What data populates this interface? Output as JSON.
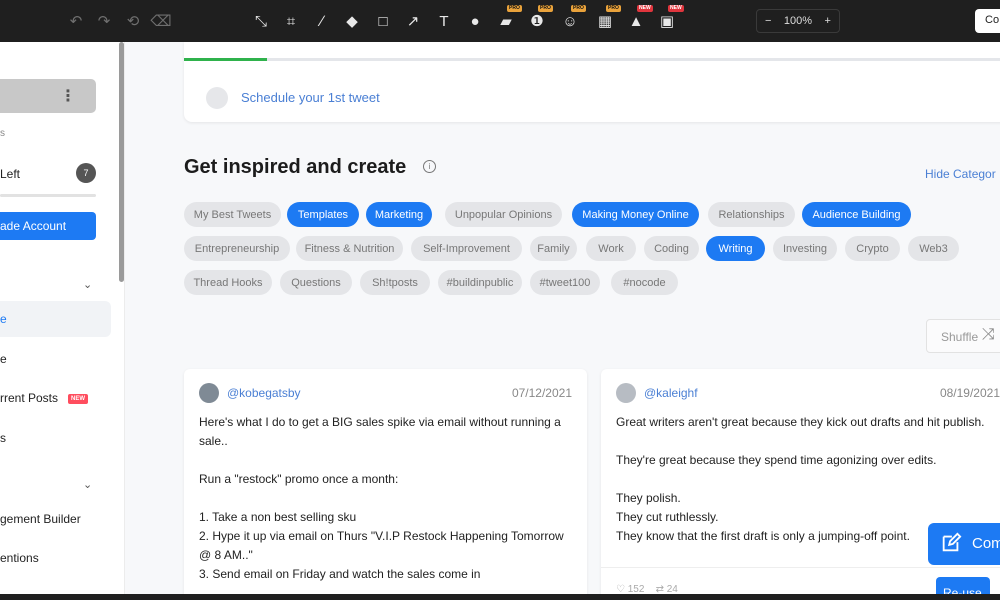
{
  "toolbar": {
    "zoom": {
      "minus": "−",
      "value": "100%",
      "plus": "+"
    },
    "right_button": "Co",
    "pro_badge": "PRO",
    "new_badge": "NEW"
  },
  "sidebar": {
    "account_menu": "⋮",
    "stat_suffix": "s",
    "left_label": "Left",
    "left_count": "7",
    "upgrade_label": "ade Account",
    "items": [
      {
        "label": "e"
      },
      {
        "label": "e"
      },
      {
        "label": "rrent Posts",
        "badge": "NEW"
      },
      {
        "label": "s"
      },
      {
        "label": "gement Builder"
      },
      {
        "label": "entions"
      }
    ]
  },
  "schedule": {
    "text": "Schedule your 1st tweet",
    "progress": 0.1
  },
  "inspire": {
    "title": "Get inspired and create",
    "hide_categories": "Hide Categor"
  },
  "categories": [
    {
      "label": "My Best Tweets",
      "active": false
    },
    {
      "label": "Templates",
      "active": true
    },
    {
      "label": "Marketing",
      "active": true
    },
    {
      "label": "Unpopular Opinions",
      "active": false
    },
    {
      "label": "Making Money Online",
      "active": true
    },
    {
      "label": "Relationships",
      "active": false
    },
    {
      "label": "Audience Building",
      "active": true
    },
    {
      "label": "Entrepreneurship",
      "active": false
    },
    {
      "label": "Fitness & Nutrition",
      "active": false
    },
    {
      "label": "Self-Improvement",
      "active": false
    },
    {
      "label": "Family",
      "active": false
    },
    {
      "label": "Work",
      "active": false
    },
    {
      "label": "Coding",
      "active": false
    },
    {
      "label": "Writing",
      "active": true
    },
    {
      "label": "Investing",
      "active": false
    },
    {
      "label": "Crypto",
      "active": false
    },
    {
      "label": "Web3",
      "active": false
    },
    {
      "label": "Thread Hooks",
      "active": false
    },
    {
      "label": "Questions",
      "active": false
    },
    {
      "label": "Sh!tposts",
      "active": false
    },
    {
      "label": "#buildinpublic",
      "active": false
    },
    {
      "label": "#tweet100",
      "active": false
    },
    {
      "label": "#nocode",
      "active": false
    }
  ],
  "shuffle_label": "Shuffle",
  "cards": [
    {
      "handle": "@kobegatsby",
      "date": "07/12/2021",
      "lines": [
        "Here's what I do to get a BIG sales spike via email without running a sale..",
        "",
        "Run a \"restock\" promo once a month:",
        "",
        "1. Take a non best selling sku",
        "2. Hype it up via email on Thurs \"V.I.P Restock Happening Tomorrow @ 8 AM..\"",
        "3. Send email on Friday and watch the sales come in"
      ]
    },
    {
      "handle": "@kaleighf",
      "date": "08/19/2021",
      "lines": [
        "Great writers aren't great because they kick out drafts and hit publish.",
        "",
        "They're great because they spend time agonizing over edits.",
        "",
        "They polish.",
        "They cut ruthlessly.",
        "They know that the first draft is only a jumping-off point."
      ],
      "likes": "152",
      "retweets": "24",
      "reuse_label": "Re-use"
    }
  ],
  "compose_label": "Com"
}
